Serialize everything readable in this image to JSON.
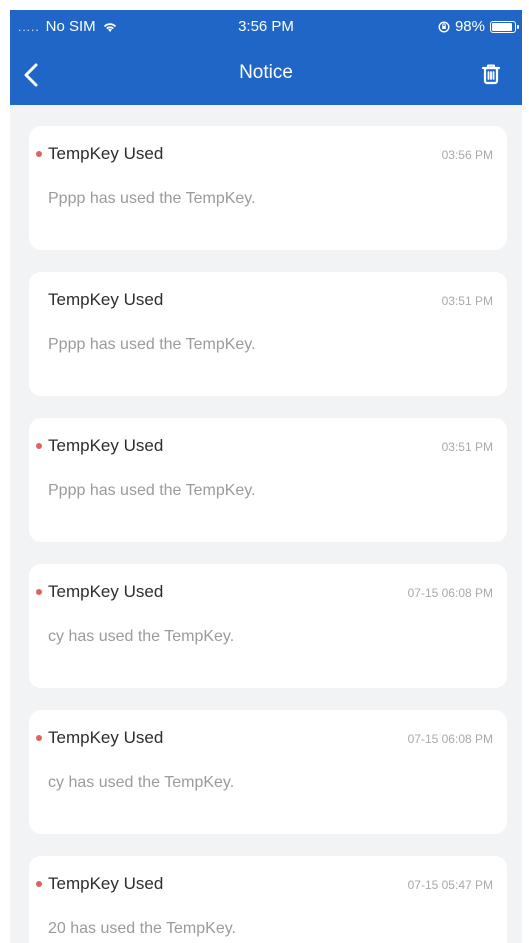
{
  "status_bar": {
    "carrier": "No SIM",
    "time": "3:56 PM",
    "battery_text": "98%",
    "battery_level": 0.98
  },
  "nav": {
    "title": "Notice",
    "back_icon": "chevron-left-icon",
    "trash_icon": "trash-icon"
  },
  "colors": {
    "header_bg": "#1f66c7",
    "background": "#f2f3f5",
    "unread_dot": "#e0625f"
  },
  "notices": [
    {
      "title": "TempKey Used",
      "time": "03:56 PM",
      "body": "Pppp has used the TempKey.",
      "unread": true
    },
    {
      "title": "TempKey Used",
      "time": "03:51 PM",
      "body": "Pppp has used the TempKey.",
      "unread": false
    },
    {
      "title": "TempKey Used",
      "time": "03:51 PM",
      "body": "Pppp has used the TempKey.",
      "unread": true
    },
    {
      "title": "TempKey Used",
      "time": "07-15 06:08 PM",
      "body": "cy has used the TempKey.",
      "unread": true
    },
    {
      "title": "TempKey Used",
      "time": "07-15 06:08 PM",
      "body": "cy has used the TempKey.",
      "unread": true
    },
    {
      "title": "TempKey Used",
      "time": "07-15 05:47 PM",
      "body": "20 has used the TempKey.",
      "unread": true
    }
  ]
}
